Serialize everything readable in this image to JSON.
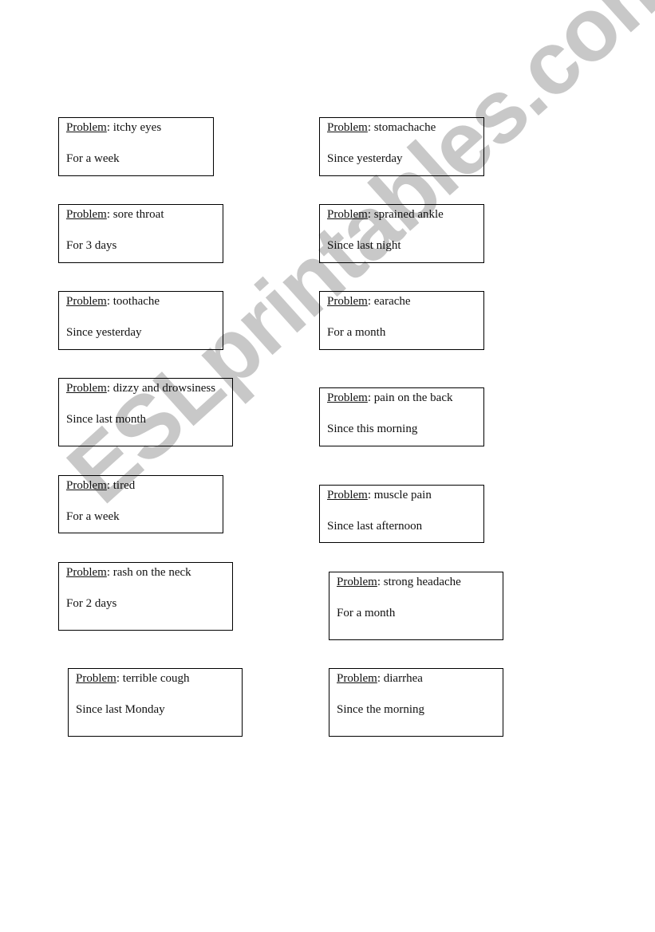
{
  "watermark": "ESLprintables.com",
  "problem_label": "Problem",
  "cards": [
    {
      "problem": "itchy eyes",
      "duration": "For a week"
    },
    {
      "problem": "stomachache",
      "duration": "Since yesterday"
    },
    {
      "problem": "sore throat",
      "duration": "For 3 days"
    },
    {
      "problem": "sprained ankle",
      "duration": "Since last night"
    },
    {
      "problem": "toothache",
      "duration": "Since yesterday"
    },
    {
      "problem": "earache",
      "duration": "For a month"
    },
    {
      "problem": "dizzy and drowsiness",
      "duration": "Since last month"
    },
    {
      "problem": "pain on the back",
      "duration": "Since this morning"
    },
    {
      "problem": "tired",
      "duration": "For a week"
    },
    {
      "problem": "muscle pain",
      "duration": "Since last afternoon"
    },
    {
      "problem": "rash on the neck",
      "duration": "For 2 days"
    },
    {
      "problem": "strong headache",
      "duration": "For a month"
    },
    {
      "problem": "terrible cough",
      "duration": "Since last Monday"
    },
    {
      "problem": "diarrhea",
      "duration": "Since the morning"
    }
  ]
}
